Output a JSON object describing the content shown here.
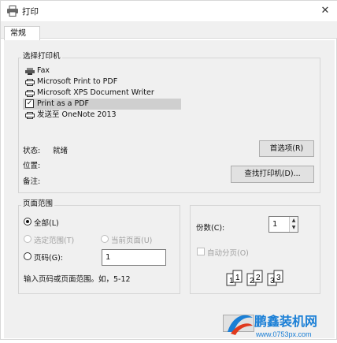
{
  "window": {
    "title": "打印",
    "close_symbol": "✕"
  },
  "tabs": [
    {
      "label": "常规"
    }
  ],
  "printer_group": {
    "legend": "选择打印机",
    "printers": [
      {
        "name": "Fax",
        "icon": "fax-printer-icon",
        "selected": false
      },
      {
        "name": "Microsoft Print to PDF",
        "icon": "printer-icon",
        "selected": false
      },
      {
        "name": "Microsoft XPS Document Writer",
        "icon": "printer-icon",
        "selected": false
      },
      {
        "name": "Print as a PDF",
        "icon": "default-printer-check-icon",
        "selected": true
      },
      {
        "name": "发送至 OneNote 2013",
        "icon": "printer-icon",
        "selected": false
      }
    ],
    "status_label": "状态:",
    "status_value": "就绪",
    "location_label": "位置:",
    "comment_label": "备注:",
    "preferences_button": "首选项(R)",
    "find_printer_button": "查找打印机(D)..."
  },
  "page_range_group": {
    "legend": "页面范围",
    "all_label": "全部(L)",
    "all_checked": true,
    "selection_label": "选定范围(T)",
    "current_page_label": "当前页面(U)",
    "pages_label": "页码(G):",
    "pages_value": "1",
    "hint": "输入页码或页面范围。如，5-12"
  },
  "copies_group": {
    "copies_label": "份数(C):",
    "copies_value": "1",
    "collate_label": "自动分页(O)",
    "collate_checked": false,
    "collate_digits": [
      "1",
      "1",
      "2",
      "2",
      "3",
      "3"
    ]
  },
  "watermark": {
    "brand": "鹏鑫装机网",
    "url": "www.0753px.com"
  },
  "colors": {
    "accent": "#1a7fd6",
    "watermark_red": "#e03a1e",
    "selected_row": "#cfcfcf"
  }
}
